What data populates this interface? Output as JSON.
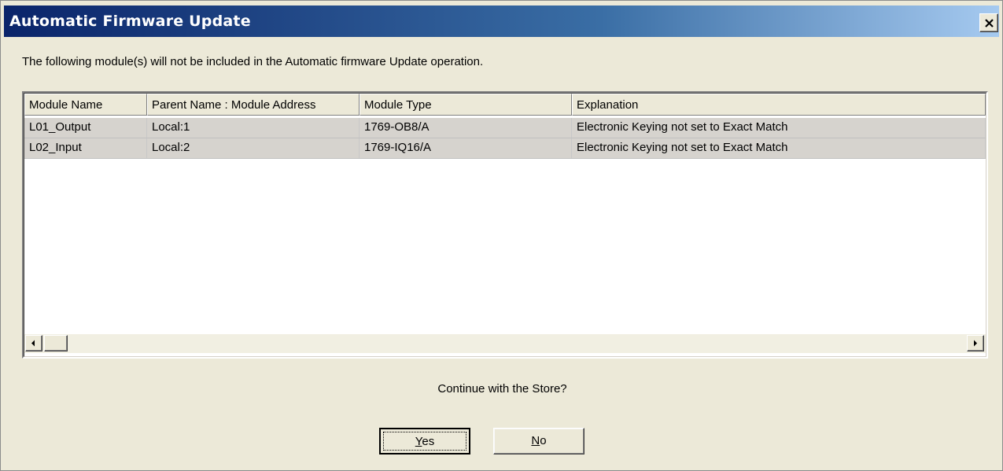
{
  "window": {
    "title": "Automatic Firmware Update",
    "close_icon": "close-icon"
  },
  "message": "The following module(s) will not be included in the Automatic firmware Update operation.",
  "table": {
    "columns": [
      "Module Name",
      "Parent Name : Module Address",
      "Module Type",
      "Explanation"
    ],
    "rows": [
      [
        "L01_Output",
        "Local:1",
        "1769-OB8/A",
        "Electronic Keying not set to Exact Match"
      ],
      [
        "L02_Input",
        "Local:2",
        "1769-IQ16/A",
        "Electronic Keying not set to Exact Match"
      ]
    ]
  },
  "question": "Continue with the Store?",
  "buttons": {
    "yes_first": "Y",
    "yes_rest": "es",
    "no_first": "N",
    "no_rest": "o"
  },
  "colors": {
    "title_start": "#0a246a",
    "title_end": "#a6caf0",
    "dialog_bg": "#ece9d8",
    "row_bg": "#d6d3ce"
  }
}
